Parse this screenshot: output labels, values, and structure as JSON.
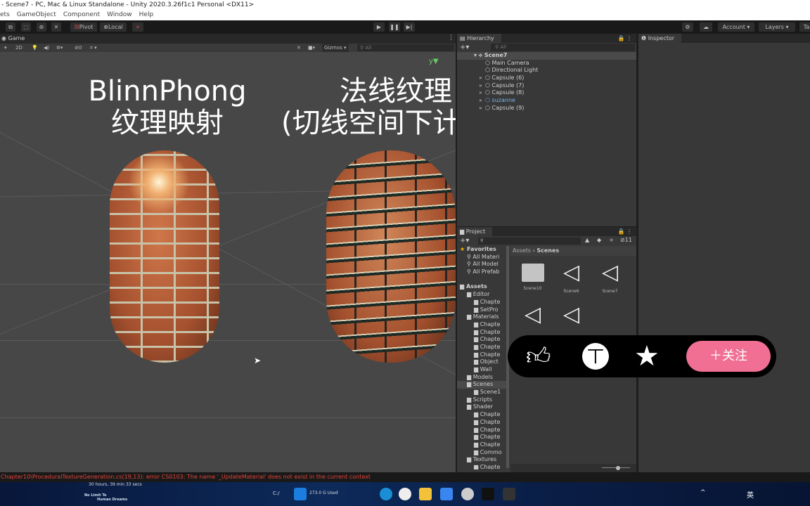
{
  "window": {
    "title": "- Scene7 - PC, Mac & Linux Standalone - Unity 2020.3.26f1c1 Personal <DX11>"
  },
  "menu": [
    "ets",
    "GameObject",
    "Component",
    "Window",
    "Help"
  ],
  "toolbar": {
    "pivot": "Pivot",
    "local": "Local",
    "account": "Account",
    "layers": "Layers",
    "tabs_label": "Ta"
  },
  "game": {
    "tab": "Game",
    "mode_2d": "2D",
    "hidden_count": "0",
    "gizmos": "Gizmos",
    "search_placeholder": "All",
    "left_caption_line1": "BlinnPhong",
    "left_caption_line2": "纹理映射",
    "right_caption_line1": "法线纹理",
    "right_caption_line2": "(切线空间下计"
  },
  "hierarchy": {
    "tab": "Hierarchy",
    "search_placeholder": "All",
    "scene": "Scene7",
    "items": [
      {
        "label": "Main Camera",
        "expandable": false
      },
      {
        "label": "Directional Light",
        "expandable": false
      },
      {
        "label": "Capsule (6)",
        "expandable": true
      },
      {
        "label": "Capsule (7)",
        "expandable": true
      },
      {
        "label": "Capsule (8)",
        "expandable": true
      },
      {
        "label": "suzanne",
        "expandable": true,
        "prefab": true
      },
      {
        "label": "Capsule (9)",
        "expandable": true
      }
    ]
  },
  "inspector": {
    "tab": "Inspector"
  },
  "project": {
    "tab": "Project",
    "hidden_count": "11",
    "breadcrumb": [
      "Assets",
      "Scenes"
    ],
    "tree": [
      {
        "label": "Favorites",
        "depth": 0,
        "bold": true,
        "icon": "star"
      },
      {
        "label": "All Materi",
        "depth": 1,
        "icon": "search"
      },
      {
        "label": "All Model",
        "depth": 1,
        "icon": "search"
      },
      {
        "label": "All Prefab",
        "depth": 1,
        "icon": "search"
      },
      {
        "label": "",
        "depth": 0,
        "icon": ""
      },
      {
        "label": "Assets",
        "depth": 0,
        "bold": true,
        "icon": "folder"
      },
      {
        "label": "Editor",
        "depth": 1,
        "icon": "folder"
      },
      {
        "label": "Chapte",
        "depth": 2,
        "icon": "folder"
      },
      {
        "label": "SetPro",
        "depth": 2,
        "icon": "folder"
      },
      {
        "label": "Materials",
        "depth": 1,
        "icon": "folder"
      },
      {
        "label": "Chapte",
        "depth": 2,
        "icon": "folder"
      },
      {
        "label": "Chapte",
        "depth": 2,
        "icon": "folder"
      },
      {
        "label": "Chapte",
        "depth": 2,
        "icon": "folder"
      },
      {
        "label": "Chapte",
        "depth": 2,
        "icon": "folder"
      },
      {
        "label": "Chapte",
        "depth": 2,
        "icon": "folder"
      },
      {
        "label": "Object",
        "depth": 2,
        "icon": "folder"
      },
      {
        "label": "Wall",
        "depth": 2,
        "icon": "folder"
      },
      {
        "label": "Models",
        "depth": 1,
        "icon": "folder"
      },
      {
        "label": "Scenes",
        "depth": 1,
        "icon": "folder",
        "selected": true
      },
      {
        "label": "Scene1",
        "depth": 2,
        "icon": "folder"
      },
      {
        "label": "Scripts",
        "depth": 1,
        "icon": "folder"
      },
      {
        "label": "Shader",
        "depth": 1,
        "icon": "folder"
      },
      {
        "label": "Chapte",
        "depth": 2,
        "icon": "folder"
      },
      {
        "label": "Chapte",
        "depth": 2,
        "icon": "folder"
      },
      {
        "label": "Chapte",
        "depth": 2,
        "icon": "folder"
      },
      {
        "label": "Chapte",
        "depth": 2,
        "icon": "folder"
      },
      {
        "label": "Chapte",
        "depth": 2,
        "icon": "folder"
      },
      {
        "label": "Commo",
        "depth": 2,
        "icon": "folder"
      },
      {
        "label": "Textures",
        "depth": 1,
        "icon": "folder"
      },
      {
        "label": "Chapte",
        "depth": 2,
        "icon": "folder"
      }
    ],
    "assets": [
      {
        "label": "Scene10",
        "type": "folder"
      },
      {
        "label": "Scene6",
        "type": "unity-scene"
      },
      {
        "label": "Scene7",
        "type": "unity-scene"
      },
      {
        "label": "",
        "type": "unity-scene"
      },
      {
        "label": "",
        "type": "unity-scene"
      }
    ]
  },
  "console": {
    "error": "Chapter10\\ProceduralTextureGeneration.cs(19,13): error CS0103: The name '_UpdateMaterial' does not exist in the current context"
  },
  "overlay": {
    "follow_label": "＋关注",
    "follow_color": "#f06f93"
  },
  "taskbar": {
    "widget1": "30 hours, 39 min 33 secs",
    "widget2_line1": "No Limit To",
    "widget2_line2": "Human Dreams",
    "drive_label": "C:/",
    "disk_used": "273.0 G Used",
    "ime": "英"
  }
}
